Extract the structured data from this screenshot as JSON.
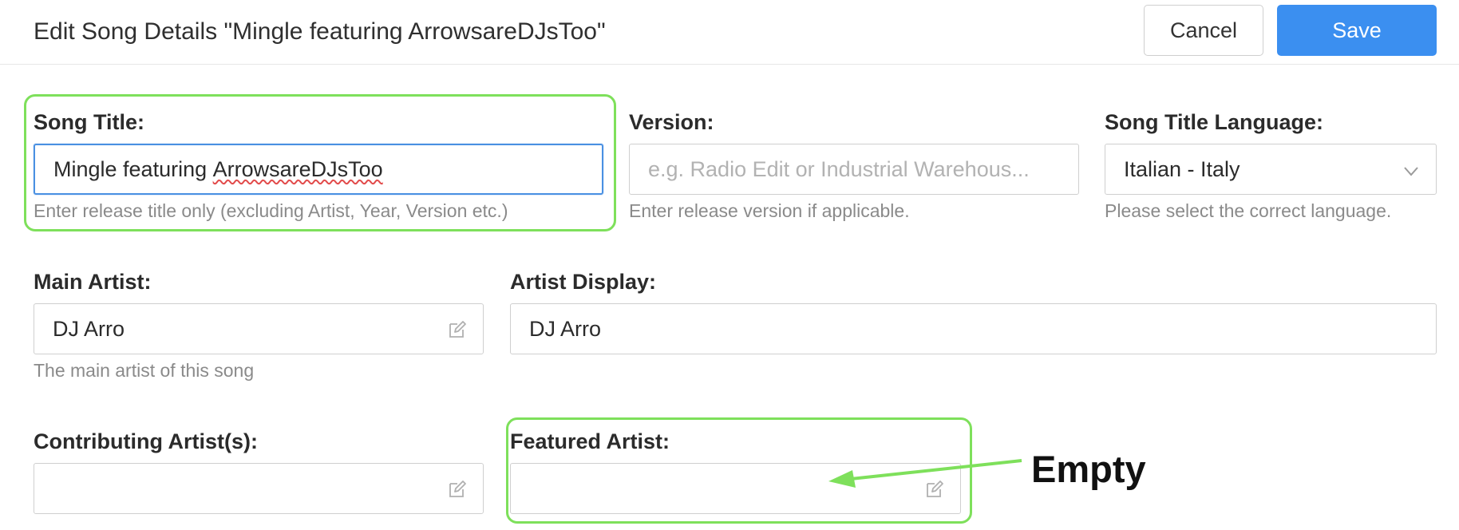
{
  "header": {
    "title": "Edit Song Details \"Mingle featuring ArrowsareDJsToo\"",
    "cancel_label": "Cancel",
    "save_label": "Save"
  },
  "song_title": {
    "label": "Song Title:",
    "value_prefix": "Mingle featuring ",
    "value_misspelled": "ArrowsareDJsToo",
    "help": "Enter release title only (excluding Artist, Year, Version etc.)"
  },
  "version": {
    "label": "Version:",
    "placeholder": "e.g. Radio Edit or Industrial Warehous...",
    "value": "",
    "help": "Enter release version if applicable."
  },
  "song_title_language": {
    "label": "Song Title Language:",
    "selected": "Italian - Italy",
    "help": "Please select the correct language."
  },
  "main_artist": {
    "label": "Main Artist:",
    "value": "DJ Arro",
    "help": "The main artist of this song"
  },
  "artist_display": {
    "label": "Artist Display:",
    "value": "DJ Arro"
  },
  "contributing_artists": {
    "label": "Contributing Artist(s):",
    "value": ""
  },
  "featured_artist": {
    "label": "Featured Artist:",
    "value": ""
  },
  "annotation": {
    "text": "Empty",
    "highlight_color": "#7ee05b"
  },
  "colors": {
    "accent": "#3b8ff0",
    "focus_border": "#4a90e2",
    "help_text": "#8a8a8a"
  },
  "icons": {
    "edit": "edit-icon",
    "dropdown": "chevron-down-icon"
  }
}
